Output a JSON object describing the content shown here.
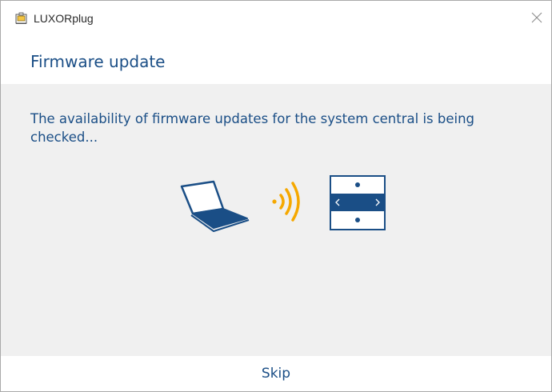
{
  "window": {
    "title": "LUXORplug",
    "app_icon": "luxorplug-app-icon",
    "close_icon": "close-icon"
  },
  "header": {
    "title": "Firmware update"
  },
  "main": {
    "message": "The availability of firmware updates for the system central is being checked...",
    "illustration": {
      "left": "laptop-icon",
      "middle": "wireless-signal-icon",
      "right": "system-central-device-icon"
    }
  },
  "footer": {
    "skip_label": "Skip"
  },
  "colors": {
    "accent": "#1a4e86",
    "signal": "#f5a800",
    "content_bg": "#f0f0f0"
  }
}
